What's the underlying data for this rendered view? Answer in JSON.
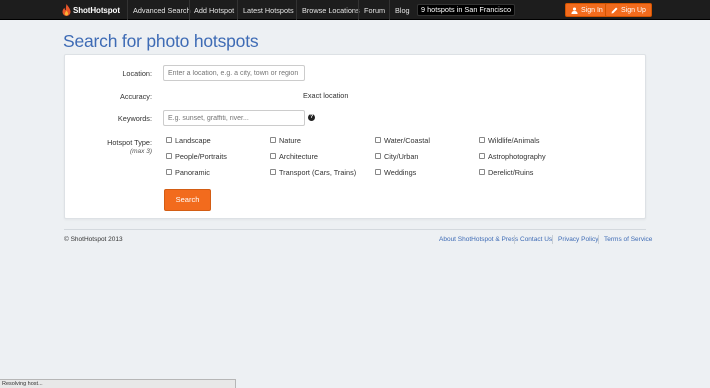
{
  "navbar": {
    "brand": "ShotHotspot",
    "links": [
      "Advanced Search",
      "Add Hotspot",
      "Latest Hotspots",
      "Browse Locations",
      "Forum",
      "Blog"
    ],
    "hotspot_count": "9 hotspots in San Francisco",
    "sign_in": "Sign In",
    "sign_up": "Sign Up",
    "accent_color": "#f26b1d"
  },
  "page": {
    "title": "Search for photo hotspots"
  },
  "form": {
    "location_label": "Location:",
    "location_placeholder": "Enter a location, e.g. a city, town or region",
    "accuracy_label": "Accuracy:",
    "accuracy_value": "Exact location",
    "keywords_label": "Keywords:",
    "keywords_placeholder": "E.g. sunset, graffiti, river...",
    "help_icon": "?",
    "type_label": "Hotspot Type:",
    "type_sublabel": "(max 3)",
    "types": [
      "Landscape",
      "Nature",
      "Water/Coastal",
      "Wildlife/Animals",
      "People/Portraits",
      "Architecture",
      "City/Urban",
      "Astrophotography",
      "Panoramic",
      "Transport (Cars, Trains)",
      "Weddings",
      "Derelict/Ruins"
    ],
    "search_button": "Search"
  },
  "footer": {
    "copyright": "© ShotHotspot 2013",
    "links": [
      "About ShotHotspot & Press",
      "Contact Us",
      "Privacy Policy",
      "Terms of Service"
    ]
  },
  "status_bar": {
    "text": "Resolving host..."
  }
}
